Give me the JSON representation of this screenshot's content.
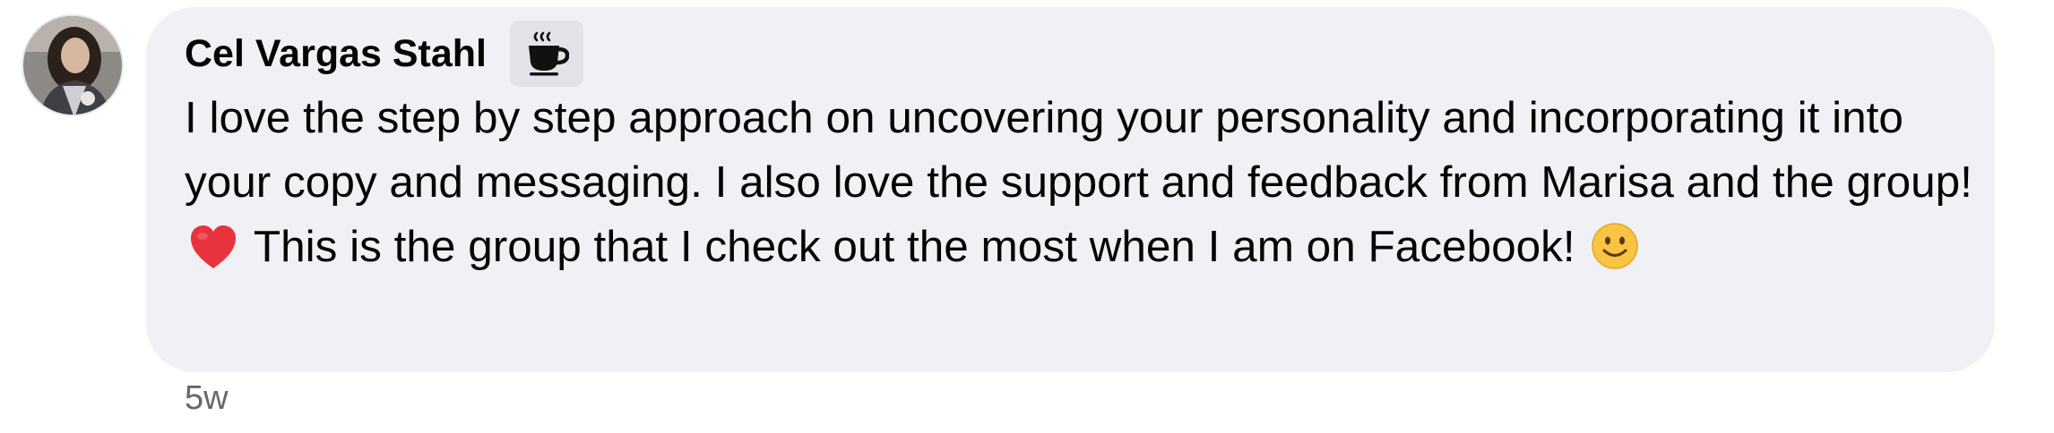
{
  "comment": {
    "author": "Cel Vargas Stahl",
    "badge_icon": "coffee-cup-icon",
    "text_part_1": "I love the step by step approach on uncovering your personality and incorporating it into your copy and messaging. I also love the support and feedback from Marisa and the group!",
    "emoji_1": "red-heart-emoji",
    "text_part_2": "This is the group that I check out the most when I am on Facebook!",
    "emoji_2": "slightly-smiling-face-emoji",
    "timestamp": "5w"
  },
  "colors": {
    "bubble_background": "#f0f0f5",
    "badge_background": "#e2e3e8",
    "text": "#050505",
    "timestamp": "#65676b",
    "heart": "#e8333e",
    "smiley": "#f8c542"
  }
}
